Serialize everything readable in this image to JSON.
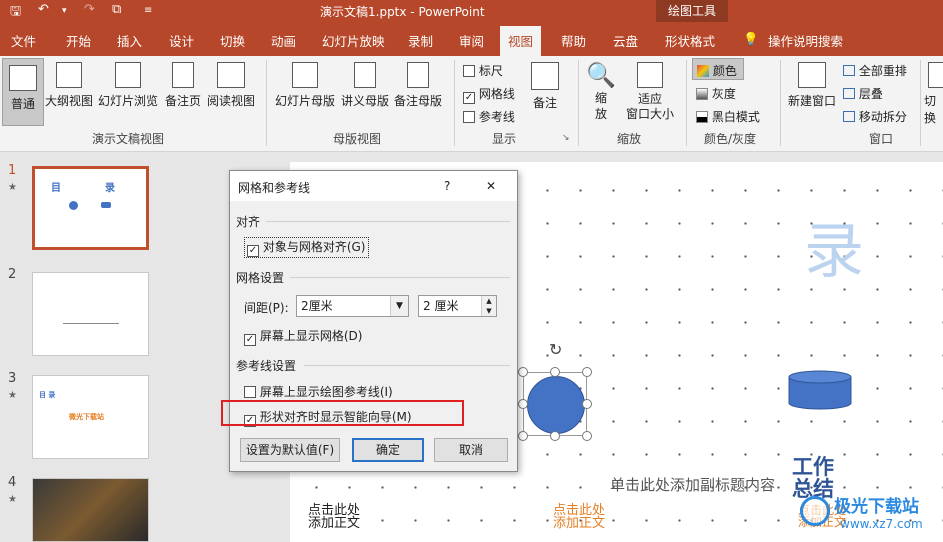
{
  "title_bar": {
    "document_title": "演示文稿1.pptx  -  PowerPoint",
    "context_tab_group": "绘图工具"
  },
  "tabs": [
    "文件",
    "开始",
    "插入",
    "设计",
    "切换",
    "动画",
    "幻灯片放映",
    "录制",
    "审阅",
    "视图",
    "帮助",
    "云盘",
    "形状格式",
    "操作说明搜索"
  ],
  "active_tab": "视图",
  "ribbon": {
    "groups": {
      "presentation_views": {
        "label": "演示文稿视图",
        "buttons": [
          "普通",
          "大纲视图",
          "幻灯片浏览",
          "备注页",
          "阅读视图"
        ]
      },
      "master_views": {
        "label": "母版视图",
        "buttons": [
          "幻灯片母版",
          "讲义母版",
          "备注母版"
        ]
      },
      "show": {
        "label": "显示",
        "checks": [
          {
            "label": "标尺",
            "checked": false
          },
          {
            "label": "网格线",
            "checked": true
          },
          {
            "label": "参考线",
            "checked": false
          }
        ],
        "notes_button": "备注"
      },
      "zoom": {
        "label": "缩放",
        "zoom_button": "缩\n放",
        "fit_button": "适应\n窗口大小"
      },
      "color": {
        "label": "颜色/灰度",
        "items": [
          "颜色",
          "灰度",
          "黑白模式"
        ]
      },
      "window": {
        "label": "窗口",
        "new_window": "新建窗口",
        "items": [
          "全部重排",
          "层叠",
          "移动拆分"
        ],
        "switch": "切换"
      }
    }
  },
  "thumbnails": [
    {
      "number": "1",
      "starred": true,
      "text": [
        "目",
        "录"
      ]
    },
    {
      "number": "2",
      "starred": false,
      "text": []
    },
    {
      "number": "3",
      "starred": true,
      "text": [
        "目 录",
        "微光下载站"
      ]
    },
    {
      "number": "4",
      "starred": true,
      "text": []
    }
  ],
  "slide": {
    "title_char": "录",
    "subtitle_placeholder": "单击此处添加副标题内容",
    "bottom_left": [
      "点击此处",
      "添加正文"
    ],
    "bottom_mid": [
      "点击此处",
      "添加正文"
    ],
    "bottom_right_big": [
      "工作",
      "总结"
    ],
    "bottom_right_small": [
      "点击此处",
      "添加正文"
    ]
  },
  "dialog": {
    "title": "网格和参考线",
    "help": "?",
    "close": "✕",
    "align_section": "对齐",
    "snap_to_grid": {
      "label": "对象与网格对齐(G)",
      "checked": true
    },
    "grid_section": "网格设置",
    "spacing_label": "间距(P):",
    "spacing_select": "2厘米",
    "spacing_value": "2 厘米",
    "show_grid": {
      "label": "屏幕上显示网格(D)",
      "checked": true
    },
    "guides_section": "参考线设置",
    "show_guides": {
      "label": "屏幕上显示绘图参考线(I)",
      "checked": false
    },
    "smart_guides": {
      "label": "形状对齐时显示智能向导(M)",
      "checked": true
    },
    "set_default": "设置为默认值(F)",
    "ok": "确定",
    "cancel": "取消"
  },
  "watermark": {
    "text": "极光下载站",
    "url": "www.xz7.com"
  },
  "colors": {
    "accent": "#b7472a",
    "highlight_box": "#e02020",
    "shape_blue": "#4472c4"
  }
}
